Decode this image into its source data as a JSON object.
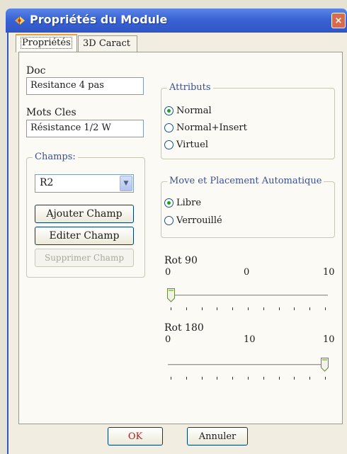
{
  "window": {
    "title": "Propriétés du Module",
    "close_label": "×"
  },
  "tabs": [
    {
      "label": "Propriétés"
    },
    {
      "label": "3D Caract"
    }
  ],
  "doc": {
    "label": "Doc",
    "value": "Resitance 4 pas"
  },
  "keywords": {
    "label": "Mots Cles",
    "value": "Résistance 1/2 W"
  },
  "fields": {
    "legend": "Champs:",
    "selected": "R2",
    "add_button": "Ajouter Champ",
    "edit_button": "Editer Champ",
    "delete_button": "Supprimer Champ"
  },
  "attributes": {
    "legend": "Attributs",
    "options": [
      {
        "label": "Normal",
        "selected": true
      },
      {
        "label": "Normal+Insert",
        "selected": false
      },
      {
        "label": "Virtuel",
        "selected": false
      }
    ]
  },
  "placement": {
    "legend": "Move et Placement Automatique",
    "options": [
      {
        "label": "Libre",
        "selected": true
      },
      {
        "label": "Verrouillé",
        "selected": false
      }
    ]
  },
  "rot90": {
    "label": "Rot 90",
    "min": "0",
    "value": "0",
    "max": "10",
    "position": 0
  },
  "rot180": {
    "label": "Rot 180",
    "min": "0",
    "value": "10",
    "max": "10",
    "position": 1
  },
  "footer": {
    "ok_label": "OK",
    "cancel_label": "Annuler"
  }
}
